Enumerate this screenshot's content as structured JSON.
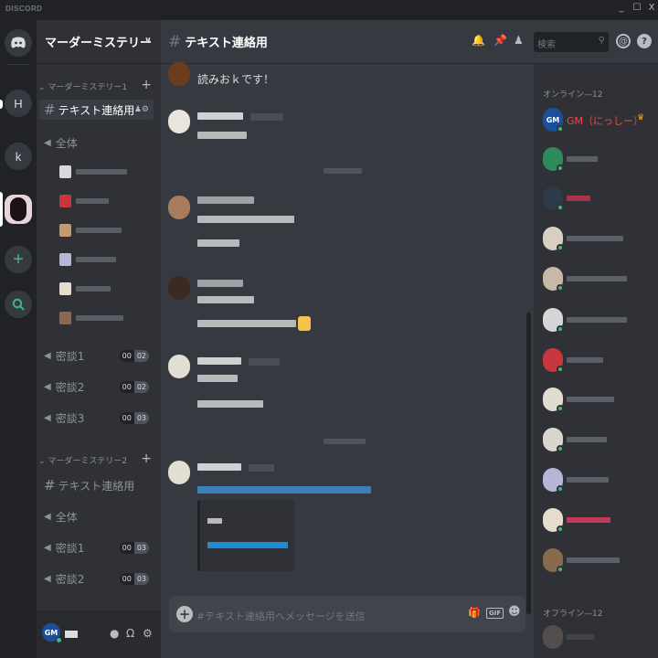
{
  "window": {
    "brand": "DISCORD",
    "minimize": "_",
    "maximize": "☐",
    "close": "X"
  },
  "servers": [
    {
      "letter": "H"
    },
    {
      "letter": "k"
    }
  ],
  "guild": {
    "name": "マーダーミステリー",
    "categories": [
      {
        "name": "マーダーミステリー1",
        "text_channel": "テキスト連絡用",
        "voice": [
          {
            "name": "全体"
          },
          {
            "name": "密談1",
            "a": "00",
            "b": "02"
          },
          {
            "name": "密談2",
            "a": "00",
            "b": "02"
          },
          {
            "name": "密談3",
            "a": "00",
            "b": "03"
          }
        ]
      },
      {
        "name": "マーダーミステリー2",
        "text_channel": "テキスト連絡用",
        "voice": [
          {
            "name": "全体"
          },
          {
            "name": "密談1",
            "a": "00",
            "b": "03"
          },
          {
            "name": "密談2",
            "a": "00",
            "b": "03"
          }
        ]
      }
    ]
  },
  "user": {
    "avatar_text": "GM"
  },
  "channel": {
    "title": "テキスト連絡用",
    "search_placeholder": "検索"
  },
  "messages": {
    "first_text": "読みおｋです！"
  },
  "composer": {
    "placeholder": "#テキスト連絡用へメッセージを送信",
    "gif": "GIF"
  },
  "member_list": {
    "online_header": "オンライン—12",
    "offline_header": "オフライン—12",
    "gm": {
      "avatar_text": "GM",
      "name": "GM（にっしー）",
      "name_color": "#f04747",
      "crown": "♛"
    }
  },
  "icons": [
    "discord-home-icon",
    "plus-icon",
    "explore-icon",
    "hash-icon",
    "speaker-icon",
    "bell-icon",
    "pin-icon",
    "members-icon",
    "search-icon",
    "mention-icon",
    "help-icon",
    "mic-icon",
    "headphones-icon",
    "settings-icon",
    "gift-icon",
    "gif-icon",
    "emoji-icon",
    "crown-icon"
  ],
  "colors": {
    "accent": "#7289da",
    "online": "#43b581",
    "link": "#00b0f4"
  }
}
